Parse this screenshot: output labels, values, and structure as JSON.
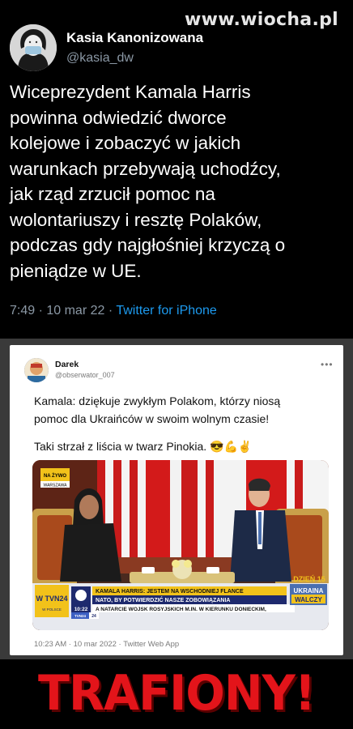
{
  "watermark": "www.wiocha.pl",
  "main_tweet": {
    "name": "Kasia Kanonizowana",
    "handle": "@kasia_dw",
    "lines": [
      "Wiceprezydent Kamala Harris",
      "powinna odwiedzić dworce",
      "kolejowe i zobaczyć w jakich",
      "warunkach przebywają uchodźcy,",
      "jak rząd zrzucił pomoc na",
      "wolontariuszy i resztę Polaków,",
      "podczas gdy najgłośniej krzyczą o",
      "pieniądze w UE."
    ],
    "time": "7:49 · 10 mar 22 ·",
    "source": "Twitter for iPhone"
  },
  "quoted_tweet": {
    "name": "Darek",
    "handle": "@obserwator_007",
    "more": "•••",
    "para1": [
      "Kamala: dziękuje zwykłym Polakom, którzy niosą",
      "pomoc dla Ukraińców w swoim wolnym czasie!"
    ],
    "para2": "Taki strzał z liścia w twarz Pinokia.",
    "emojis": "😎💪✌",
    "meta": "10:23 AM · 10 mar 2022 · Twitter Web App"
  },
  "tv": {
    "live_badge": "NA ŻYWO",
    "location": "WARSZAWA",
    "channel": "W TVN24",
    "channel_sub": "W POLSCE",
    "headline1": "KAMALA HARRIS: JESTEM NA WSCHODNIEJ FLANCE",
    "headline2": "NATO, BY POTWIERDZIĆ NASZE ZOBOWIĄZANIA",
    "clock": "10:22",
    "ticker": "A NATARCIE WOJSK ROSYJSKICH M.IN. W KIERUNKU DONIECKIM,",
    "tag_channel": "TVN24",
    "tag_num": "24",
    "day_badge": "DZIEŃ 15",
    "war_badge_line1": "UKRAINA",
    "war_badge_line2": "WALCZY"
  },
  "caption": "TRAFIONY!",
  "colors": {
    "link": "#1d9bf0",
    "caption_red": "#e3141a",
    "tv_yellow": "#f2c21a",
    "tv_navy": "#1e2a6e"
  }
}
